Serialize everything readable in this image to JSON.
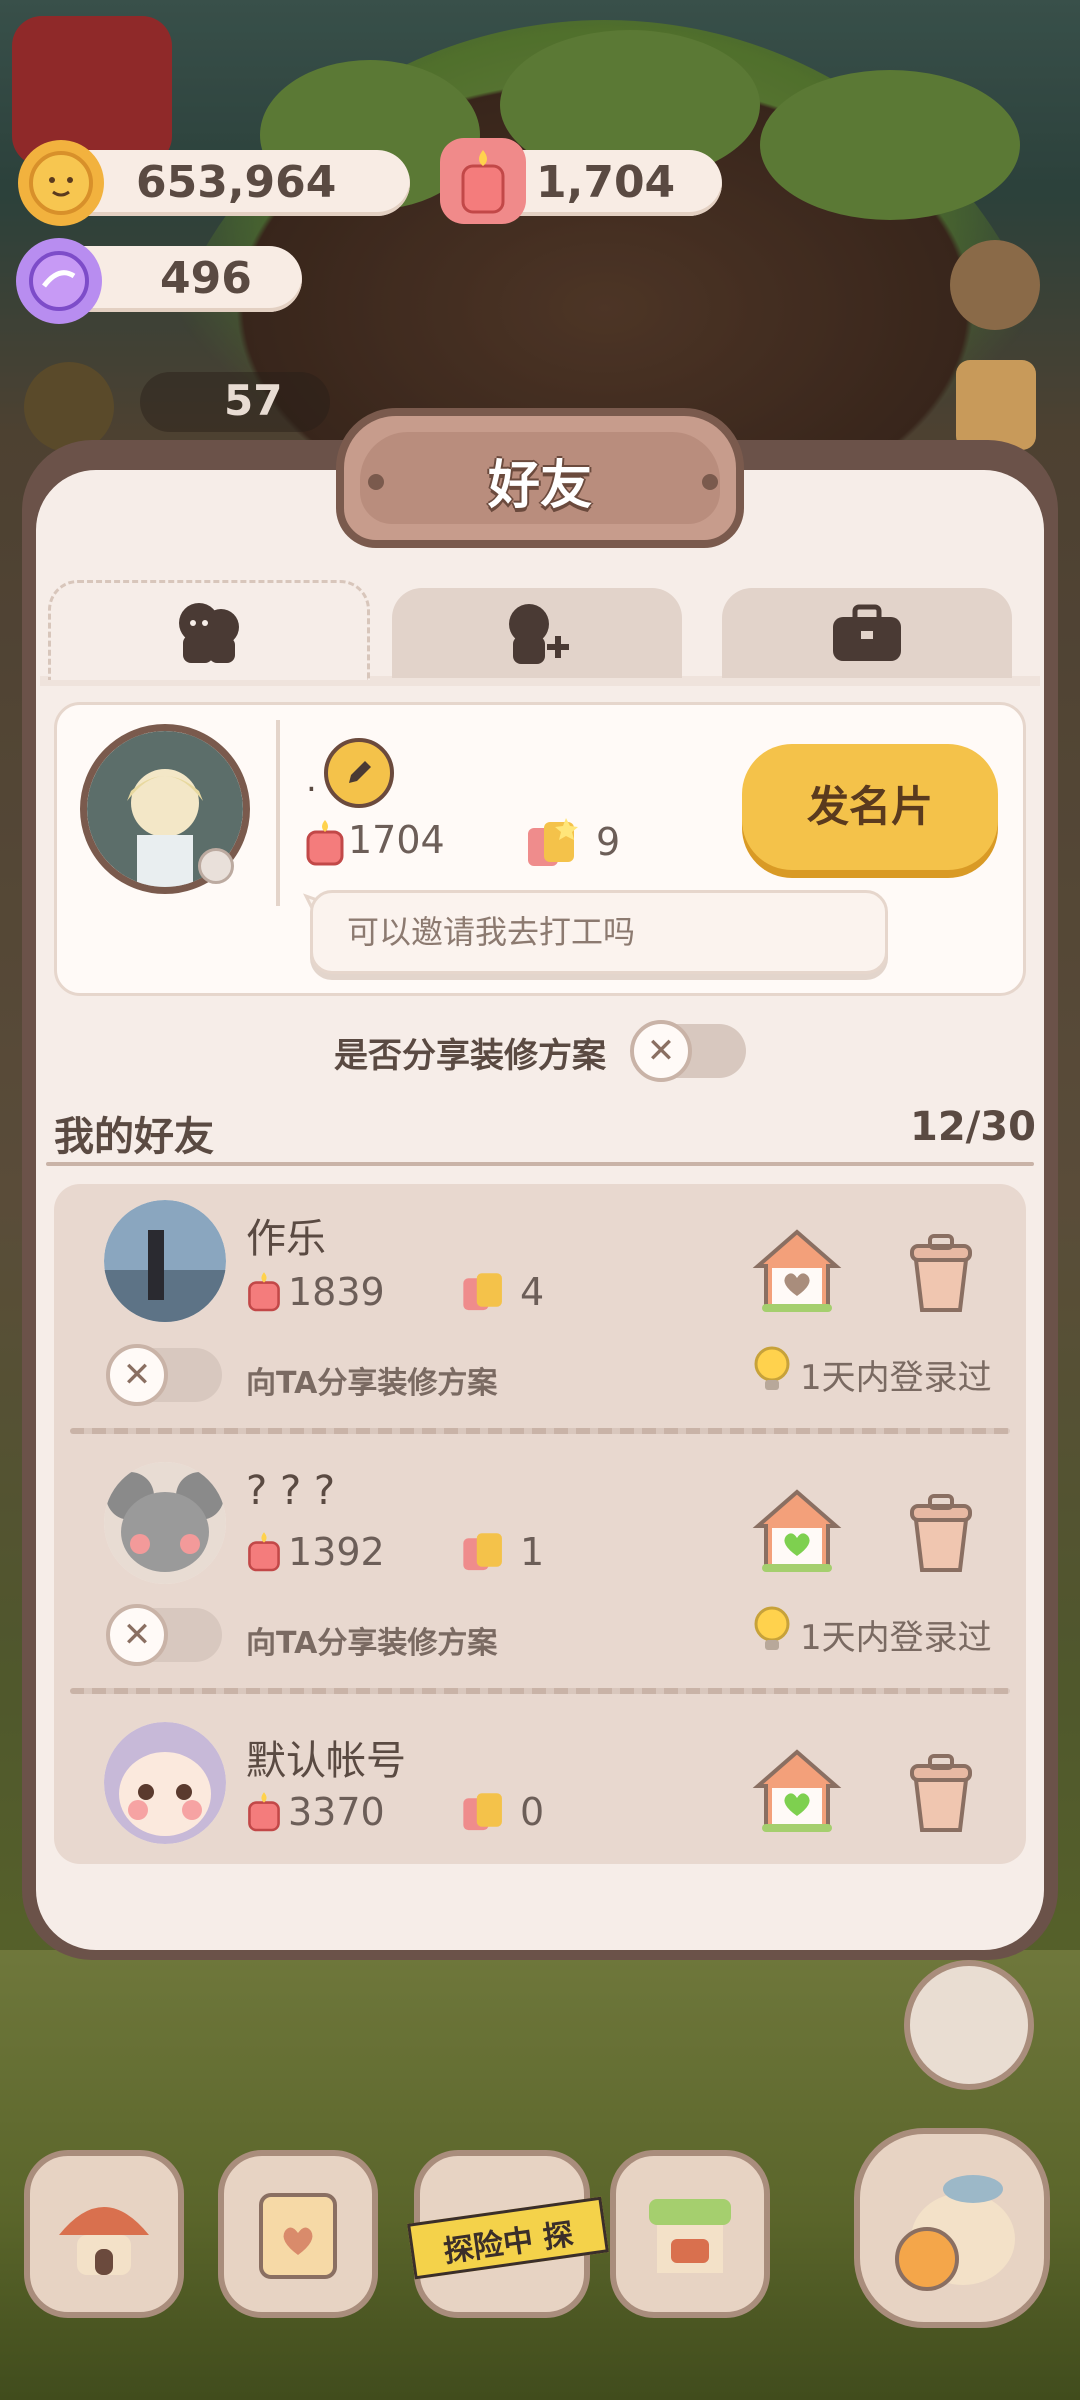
{
  "currency": {
    "coins": "653,964",
    "candles": "1,704",
    "candy": "496",
    "level_count": "57"
  },
  "panel": {
    "title": "好友",
    "tabs": [
      {
        "icon": "friends-icon",
        "active": true
      },
      {
        "icon": "add-friend-icon",
        "active": false
      },
      {
        "icon": "briefcase-icon",
        "active": false
      }
    ]
  },
  "profile": {
    "name": ".",
    "candle_count": "1704",
    "gift_count": "9",
    "send_card_label": "发名片",
    "message": "可以邀请我去打工吗"
  },
  "share_toggle_label": "是否分享装修方案",
  "friends": {
    "title": "我的好友",
    "count": "12/30",
    "items": [
      {
        "name": "作乐",
        "candles": "1839",
        "gifts": "4",
        "share_label": "向TA分享装修方案",
        "login": "1天内登录过",
        "house_color": "#a98d7c"
      },
      {
        "name": "? ? ?",
        "candles": "1392",
        "gifts": "1",
        "share_label": "向TA分享装修方案",
        "login": "1天内登录过",
        "house_color": "#7ed04f"
      },
      {
        "name": "默认帐号",
        "candles": "3370",
        "gifts": "0",
        "share_label": "",
        "login": "",
        "house_color": "#7ed04f"
      }
    ]
  },
  "bottom_nav": {
    "adventure_label": "探险中 探"
  },
  "colors": {
    "accent": "#f4c24a",
    "panel_border": "#6b5249",
    "panel_bg": "#f6ede8"
  }
}
